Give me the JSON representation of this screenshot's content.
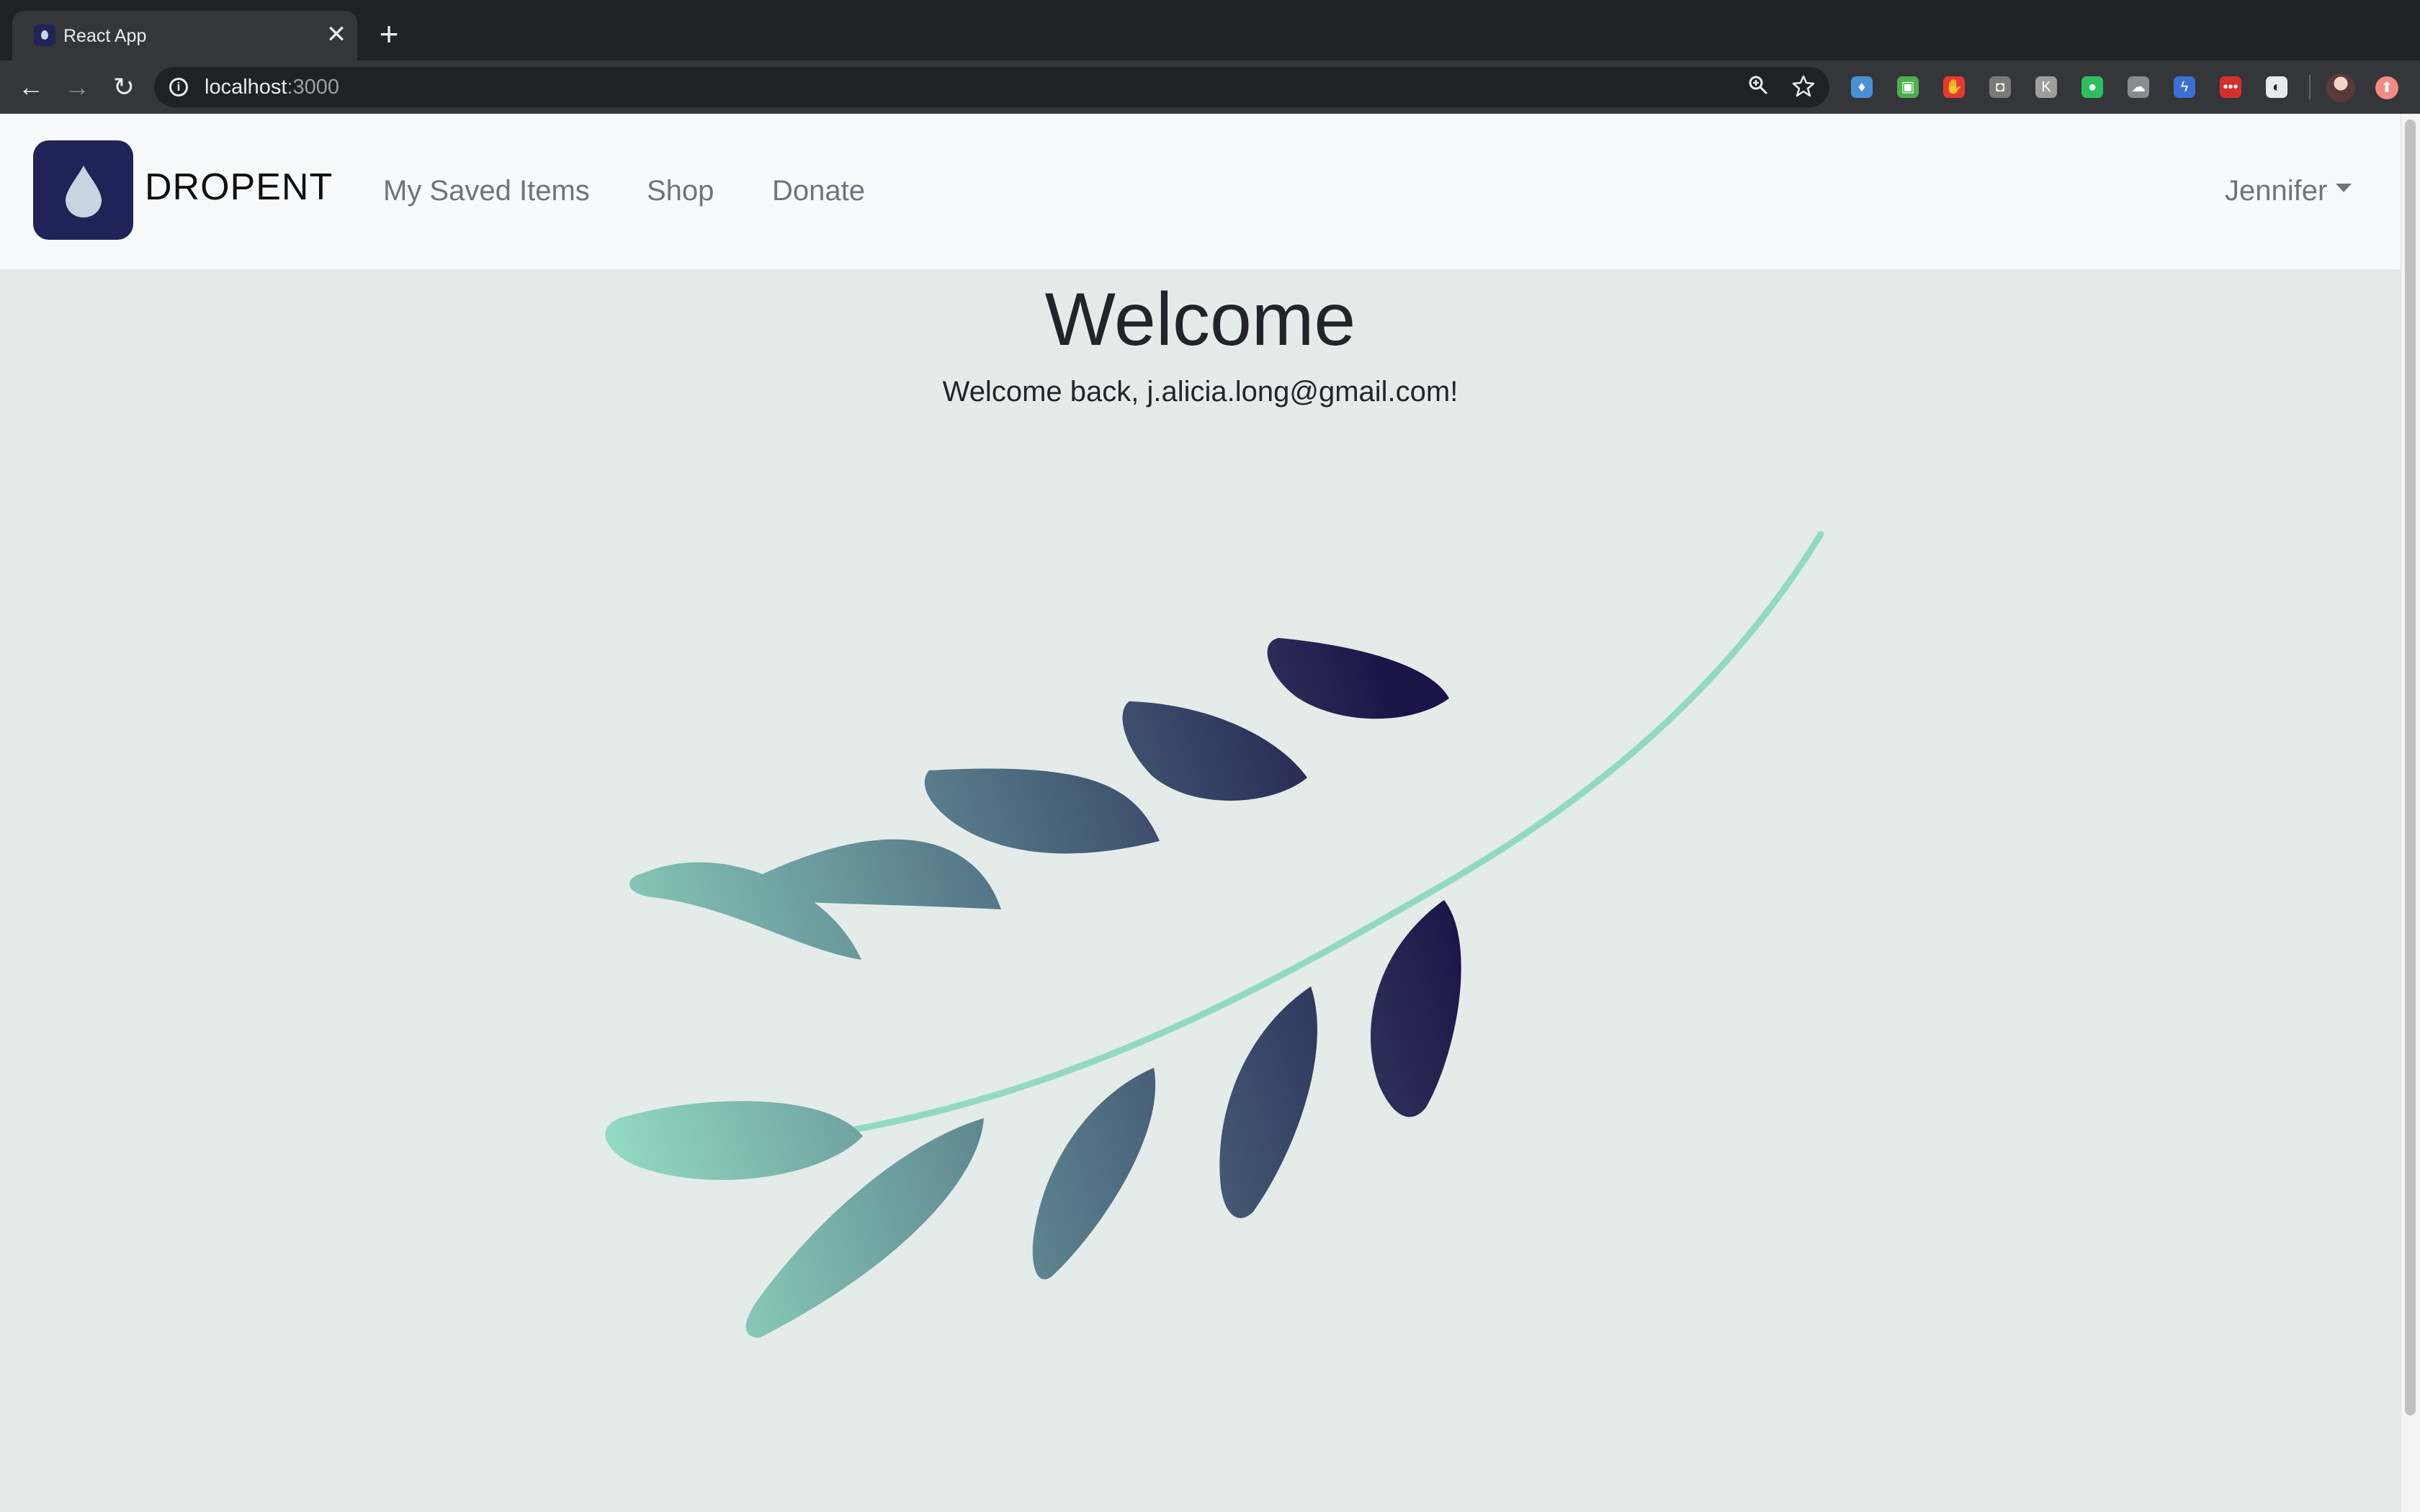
{
  "browser": {
    "tab": {
      "title": "React App",
      "close": "✕"
    },
    "new_tab": "+",
    "nav": {
      "back": "←",
      "forward": "→",
      "reload": "↻"
    },
    "address": {
      "host": "localhost",
      "port": ":3000",
      "info": "i"
    },
    "icons": {
      "zoom": "zoom-icon",
      "bookmark": "star-icon"
    },
    "extensions": [
      {
        "name": "gem-extension",
        "glyph": "♦",
        "color": "#4a90d9"
      },
      {
        "name": "green-extension",
        "glyph": "▣",
        "color": "#4caf50"
      },
      {
        "name": "adblock-extension",
        "glyph": "✋",
        "color": "#e53935"
      },
      {
        "name": "grey-extension",
        "glyph": "◘",
        "color": "#7a7a7a"
      },
      {
        "name": "light-extension",
        "glyph": "K",
        "color": "#9e9e9e"
      },
      {
        "name": "evernote-extension",
        "glyph": "●",
        "color": "#2dbe60"
      },
      {
        "name": "cloud-extension",
        "glyph": "☁",
        "color": "#8a8b8f"
      },
      {
        "name": "blue-extension",
        "glyph": "ϟ",
        "color": "#3b6fd4"
      },
      {
        "name": "lastpass-extension",
        "glyph": "•••",
        "color": "#d32f2f"
      },
      {
        "name": "white-extension",
        "glyph": "◐",
        "color": "#e8eaed"
      }
    ],
    "update": "⬆"
  },
  "app": {
    "brand": "DROPENT",
    "nav_links": [
      "My Saved Items",
      "Shop",
      "Donate"
    ],
    "user": "Jennifer",
    "welcome_title": "Welcome",
    "welcome_message": "Welcome back, j.alicia.long@gmail.com!"
  },
  "colors": {
    "brand_logo_bg": "#1f2357",
    "stem": "#92d9c2",
    "leaf_light": "#92d9c2",
    "leaf_mid": "#5a7f8c",
    "leaf_dark": "#1b1447",
    "page_bg": "#e4ecea"
  }
}
